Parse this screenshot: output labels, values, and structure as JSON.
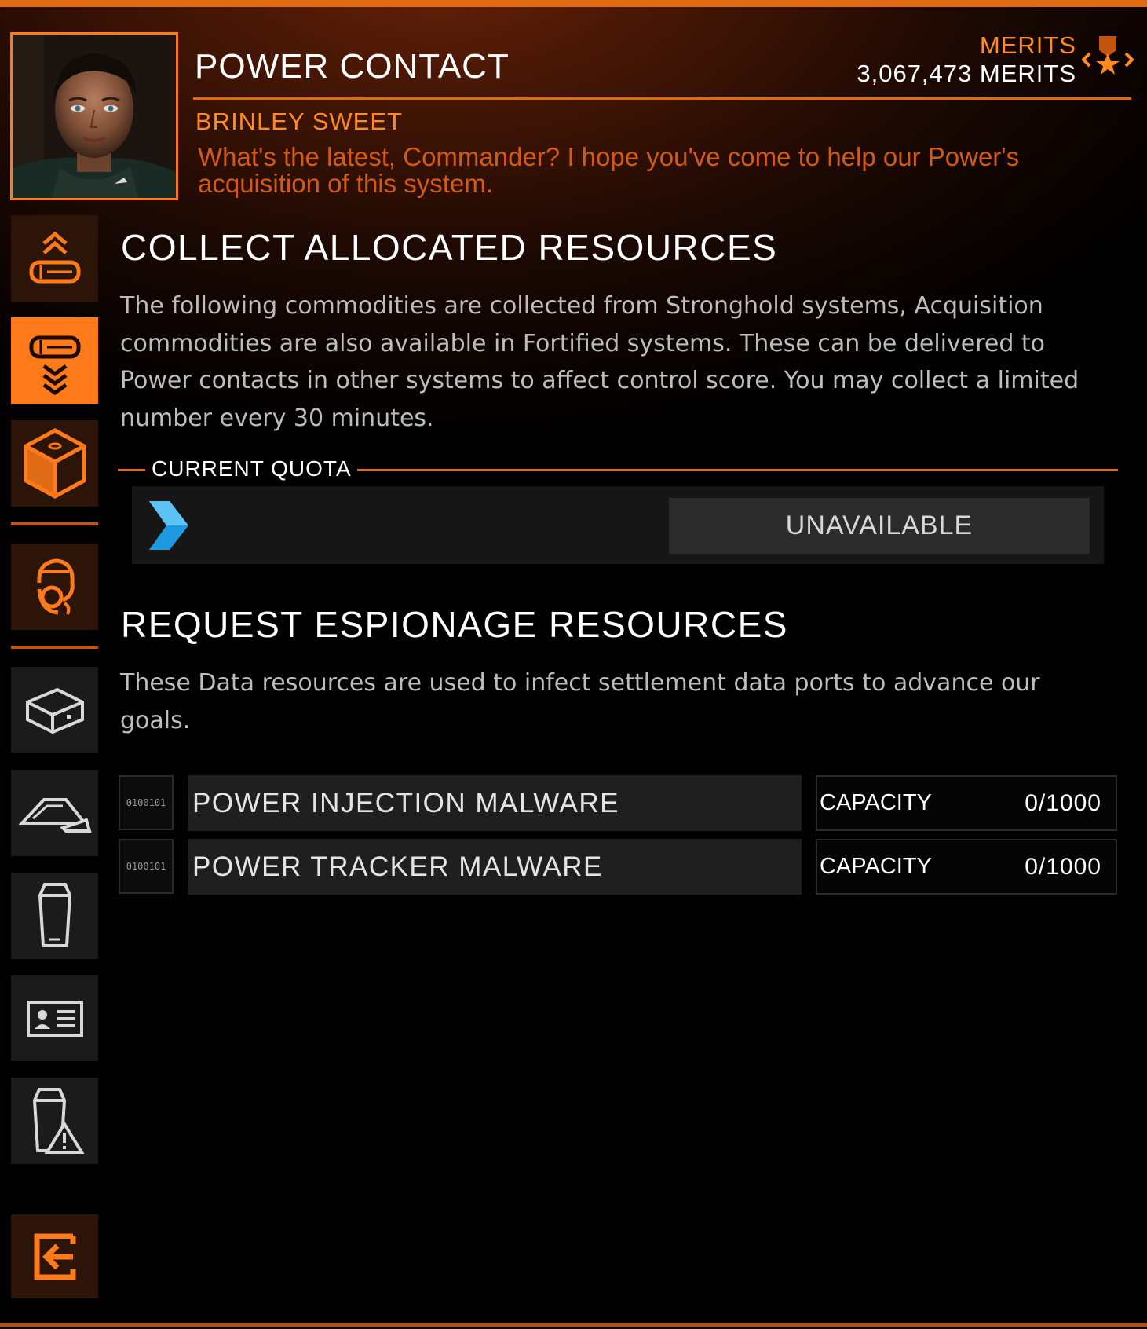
{
  "header": {
    "title": "POWER CONTACT",
    "merits_label": "MERITS",
    "merits_value": "3,067,473 MERITS",
    "contact_name": "BRINLEY SWEET",
    "contact_message": "What's the latest, Commander? I hope you've come to help our Power's acquisition of this system."
  },
  "sidebar": {
    "items": [
      {
        "icon": "collect-up-icon",
        "active": false
      },
      {
        "icon": "collect-down-icon",
        "active": true
      },
      {
        "icon": "cargo-box-icon",
        "active": false
      },
      {
        "icon": "contact-headset-icon",
        "active": false
      },
      {
        "icon": "commodity-crate-icon",
        "active": false
      },
      {
        "icon": "data-wedge-icon",
        "active": false
      },
      {
        "icon": "canister-icon",
        "active": false
      },
      {
        "icon": "id-card-icon",
        "active": false
      },
      {
        "icon": "hazard-canister-icon",
        "active": false
      },
      {
        "icon": "exit-icon",
        "active": false
      }
    ]
  },
  "collect": {
    "title": "COLLECT ALLOCATED RESOURCES",
    "description": "The following commodities are collected from Stronghold systems, Acquisition commodities are also available in Fortified systems. These can be delivered to Power contacts in other systems to affect control score. You may collect a limited number every 30 minutes.",
    "quota_label": "CURRENT QUOTA",
    "status_button": "UNAVAILABLE"
  },
  "espionage": {
    "title": "REQUEST ESPIONAGE RESOURCES",
    "description": "These Data resources are used to infect settlement data ports to advance our goals.",
    "resources": [
      {
        "icon_text": "0100101",
        "name": "POWER INJECTION MALWARE",
        "capacity_label": "CAPACITY",
        "capacity_value": "0/1000"
      },
      {
        "icon_text": "0100101",
        "name": "POWER TRACKER MALWARE",
        "capacity_label": "CAPACITY",
        "capacity_value": "0/1000"
      }
    ]
  },
  "colors": {
    "accent": "#ff7a1a",
    "accent_dark": "#e06a10",
    "chevron_blue": "#1e9be0",
    "panel": "#1f1f1f"
  }
}
